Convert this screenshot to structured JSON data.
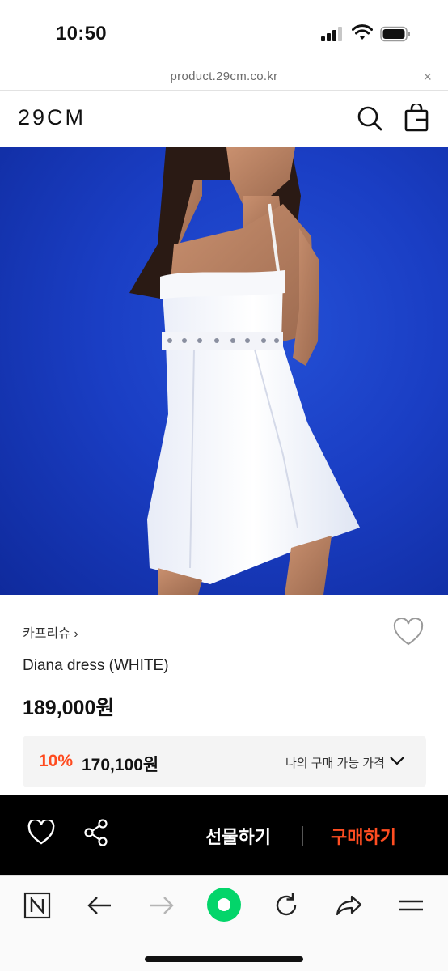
{
  "status_bar": {
    "time": "10:50",
    "icons": [
      "cellular-signal-icon",
      "wifi-icon",
      "battery-icon"
    ]
  },
  "browser": {
    "url": "product.29cm.co.kr",
    "close_glyph": "×"
  },
  "header": {
    "logo": "29CM",
    "icons": [
      "search-icon",
      "shopping-bag-icon"
    ]
  },
  "product": {
    "image_alt": "Model in white mini dress with eyelet waist band on blue background",
    "brand": "카프리슈",
    "brand_chevron": "›",
    "name": "Diana dress (WHITE)",
    "price": "189,000원",
    "my_price": {
      "discount_rate": "10%",
      "price": "170,100원",
      "label": "나의 구매 가능 가격"
    }
  },
  "purchase_bar": {
    "gift_label": "선물하기",
    "buy_label": "구매하기",
    "icons": [
      "heart-icon",
      "share-icon"
    ]
  },
  "toolbar": {
    "items": [
      "naver-n-icon",
      "back-arrow-icon",
      "forward-arrow-icon",
      "green-dot-icon",
      "reload-icon",
      "share-arrow-icon",
      "menu-icon"
    ]
  },
  "colors": {
    "accent": "#ff4b1f",
    "purchase_bar_bg": "#000000",
    "image_bg": "#1a3ec4",
    "green_button": "#03d56a"
  }
}
